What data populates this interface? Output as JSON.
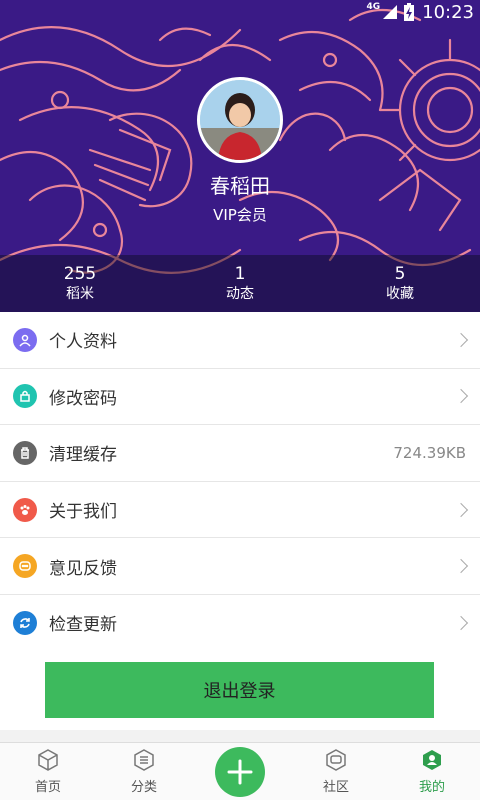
{
  "status_bar": {
    "network": "4G",
    "time": "10:23"
  },
  "profile": {
    "name": "春稻田",
    "membership": "VIP会员"
  },
  "stats": [
    {
      "value": "255",
      "label": "稻米"
    },
    {
      "value": "1",
      "label": "动态"
    },
    {
      "value": "5",
      "label": "收藏"
    }
  ],
  "menu": {
    "items": [
      {
        "label": "个人资料",
        "icon": "person-icon",
        "color": "#7b6cf0"
      },
      {
        "label": "修改密码",
        "icon": "lock-icon",
        "color": "#20c4b0"
      },
      {
        "label": "清理缓存",
        "icon": "trash-icon",
        "color": "#666666",
        "value": "724.39KB"
      },
      {
        "label": "关于我们",
        "icon": "paw-icon",
        "color": "#f05a4a"
      },
      {
        "label": "意见反馈",
        "icon": "chat-icon",
        "color": "#f5a623"
      },
      {
        "label": "检查更新",
        "icon": "refresh-icon",
        "color": "#1e7fd6"
      }
    ]
  },
  "logout": {
    "label": "退出登录"
  },
  "tabbar": {
    "tabs": [
      {
        "label": "首页",
        "icon": "home-cube-icon"
      },
      {
        "label": "分类",
        "icon": "category-list-icon"
      },
      {
        "label": "",
        "icon": "plus-icon"
      },
      {
        "label": "社区",
        "icon": "community-chat-icon"
      },
      {
        "label": "我的",
        "icon": "profile-icon",
        "active": true
      }
    ]
  },
  "colors": {
    "header_bg": "#3a1a86",
    "pattern": "#e9869a",
    "accent_green": "#3dba5d"
  }
}
